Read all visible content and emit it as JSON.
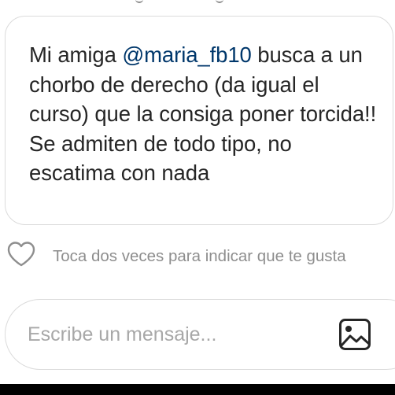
{
  "message": {
    "text_before_mention": "Mi amiga ",
    "mention": "@maria_fb10",
    "text_after_mention": " busca a un chorbo de derecho (da igual el curso) que la consiga poner torcida!! Se admiten de todo tipo, no escatima con nada"
  },
  "like": {
    "icon": "heart-outline-icon",
    "hint": "Toca dos veces para indicar que te gusta"
  },
  "composer": {
    "placeholder": "Escribe un mensaje...",
    "value": "",
    "gallery_icon": "image-gallery-icon"
  },
  "colors": {
    "text": "#262626",
    "mention": "#00376b",
    "muted": "#8e8e8e",
    "placeholder": "#a8a8a8",
    "border": "#dbdbdb"
  }
}
